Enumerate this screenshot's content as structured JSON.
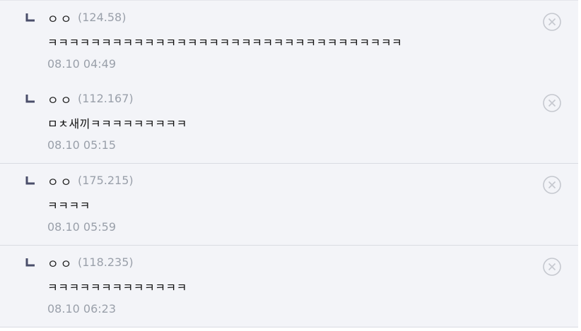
{
  "comments": [
    {
      "author": "ㅇㅇ",
      "ip": "(124.58)",
      "text": "ㅋㅋㅋㅋㅋㅋㅋㅋㅋㅋㅋㅋㅋㅋㅋㅋㅋㅋㅋㅋㅋㅋㅋㅋㅋㅋㅋㅋㅋㅋㅋㅋㅋ",
      "time": "08.10 04:49"
    },
    {
      "author": "ㅇㅇ",
      "ip": "(112.167)",
      "text": "ㅁㅊ새끼ㅋㅋㅋㅋㅋㅋㅋㅋㅋ",
      "time": "08.10 05:15"
    },
    {
      "author": "ㅇㅇ",
      "ip": "(175.215)",
      "text": "ㅋㅋㅋㅋ",
      "time": "08.10 05:59"
    },
    {
      "author": "ㅇㅇ",
      "ip": "(118.235)",
      "text": "ㅋㅋㅋㅋㅋㅋㅋㅋㅋㅋㅋㅋㅋ",
      "time": "08.10 06:23"
    }
  ],
  "icons": {
    "reply": "reply-arrow-icon",
    "delete": "close-circle-icon"
  },
  "colors": {
    "row_bg": "#f3f4f8",
    "meta_gray": "#9aa0aa",
    "reply_icon": "#4a4e6a"
  }
}
